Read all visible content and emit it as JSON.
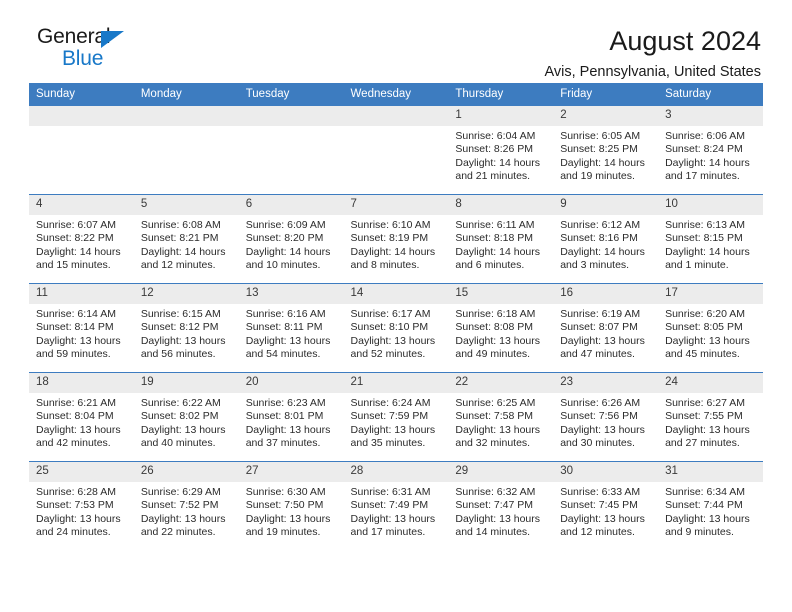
{
  "logo": {
    "word1": "General",
    "word2": "Blue",
    "triangle_color": "#1878c8",
    "icon": "triangle-icon"
  },
  "header": {
    "title": "August 2024",
    "subtitle": "Avis, Pennsylvania, United States"
  },
  "theme": {
    "header_band": "#3d7cc0",
    "daynum_band": "#ececec",
    "text": "#2b2b2b"
  },
  "weekday_headers": [
    "Sunday",
    "Monday",
    "Tuesday",
    "Wednesday",
    "Thursday",
    "Friday",
    "Saturday"
  ],
  "weeks": [
    [
      {
        "day": "",
        "lines": []
      },
      {
        "day": "",
        "lines": []
      },
      {
        "day": "",
        "lines": []
      },
      {
        "day": "",
        "lines": []
      },
      {
        "day": "1",
        "lines": [
          "Sunrise: 6:04 AM",
          "Sunset: 8:26 PM",
          "Daylight: 14 hours",
          "and 21 minutes."
        ]
      },
      {
        "day": "2",
        "lines": [
          "Sunrise: 6:05 AM",
          "Sunset: 8:25 PM",
          "Daylight: 14 hours",
          "and 19 minutes."
        ]
      },
      {
        "day": "3",
        "lines": [
          "Sunrise: 6:06 AM",
          "Sunset: 8:24 PM",
          "Daylight: 14 hours",
          "and 17 minutes."
        ]
      }
    ],
    [
      {
        "day": "4",
        "lines": [
          "Sunrise: 6:07 AM",
          "Sunset: 8:22 PM",
          "Daylight: 14 hours",
          "and 15 minutes."
        ]
      },
      {
        "day": "5",
        "lines": [
          "Sunrise: 6:08 AM",
          "Sunset: 8:21 PM",
          "Daylight: 14 hours",
          "and 12 minutes."
        ]
      },
      {
        "day": "6",
        "lines": [
          "Sunrise: 6:09 AM",
          "Sunset: 8:20 PM",
          "Daylight: 14 hours",
          "and 10 minutes."
        ]
      },
      {
        "day": "7",
        "lines": [
          "Sunrise: 6:10 AM",
          "Sunset: 8:19 PM",
          "Daylight: 14 hours",
          "and 8 minutes."
        ]
      },
      {
        "day": "8",
        "lines": [
          "Sunrise: 6:11 AM",
          "Sunset: 8:18 PM",
          "Daylight: 14 hours",
          "and 6 minutes."
        ]
      },
      {
        "day": "9",
        "lines": [
          "Sunrise: 6:12 AM",
          "Sunset: 8:16 PM",
          "Daylight: 14 hours",
          "and 3 minutes."
        ]
      },
      {
        "day": "10",
        "lines": [
          "Sunrise: 6:13 AM",
          "Sunset: 8:15 PM",
          "Daylight: 14 hours",
          "and 1 minute."
        ]
      }
    ],
    [
      {
        "day": "11",
        "lines": [
          "Sunrise: 6:14 AM",
          "Sunset: 8:14 PM",
          "Daylight: 13 hours",
          "and 59 minutes."
        ]
      },
      {
        "day": "12",
        "lines": [
          "Sunrise: 6:15 AM",
          "Sunset: 8:12 PM",
          "Daylight: 13 hours",
          "and 56 minutes."
        ]
      },
      {
        "day": "13",
        "lines": [
          "Sunrise: 6:16 AM",
          "Sunset: 8:11 PM",
          "Daylight: 13 hours",
          "and 54 minutes."
        ]
      },
      {
        "day": "14",
        "lines": [
          "Sunrise: 6:17 AM",
          "Sunset: 8:10 PM",
          "Daylight: 13 hours",
          "and 52 minutes."
        ]
      },
      {
        "day": "15",
        "lines": [
          "Sunrise: 6:18 AM",
          "Sunset: 8:08 PM",
          "Daylight: 13 hours",
          "and 49 minutes."
        ]
      },
      {
        "day": "16",
        "lines": [
          "Sunrise: 6:19 AM",
          "Sunset: 8:07 PM",
          "Daylight: 13 hours",
          "and 47 minutes."
        ]
      },
      {
        "day": "17",
        "lines": [
          "Sunrise: 6:20 AM",
          "Sunset: 8:05 PM",
          "Daylight: 13 hours",
          "and 45 minutes."
        ]
      }
    ],
    [
      {
        "day": "18",
        "lines": [
          "Sunrise: 6:21 AM",
          "Sunset: 8:04 PM",
          "Daylight: 13 hours",
          "and 42 minutes."
        ]
      },
      {
        "day": "19",
        "lines": [
          "Sunrise: 6:22 AM",
          "Sunset: 8:02 PM",
          "Daylight: 13 hours",
          "and 40 minutes."
        ]
      },
      {
        "day": "20",
        "lines": [
          "Sunrise: 6:23 AM",
          "Sunset: 8:01 PM",
          "Daylight: 13 hours",
          "and 37 minutes."
        ]
      },
      {
        "day": "21",
        "lines": [
          "Sunrise: 6:24 AM",
          "Sunset: 7:59 PM",
          "Daylight: 13 hours",
          "and 35 minutes."
        ]
      },
      {
        "day": "22",
        "lines": [
          "Sunrise: 6:25 AM",
          "Sunset: 7:58 PM",
          "Daylight: 13 hours",
          "and 32 minutes."
        ]
      },
      {
        "day": "23",
        "lines": [
          "Sunrise: 6:26 AM",
          "Sunset: 7:56 PM",
          "Daylight: 13 hours",
          "and 30 minutes."
        ]
      },
      {
        "day": "24",
        "lines": [
          "Sunrise: 6:27 AM",
          "Sunset: 7:55 PM",
          "Daylight: 13 hours",
          "and 27 minutes."
        ]
      }
    ],
    [
      {
        "day": "25",
        "lines": [
          "Sunrise: 6:28 AM",
          "Sunset: 7:53 PM",
          "Daylight: 13 hours",
          "and 24 minutes."
        ]
      },
      {
        "day": "26",
        "lines": [
          "Sunrise: 6:29 AM",
          "Sunset: 7:52 PM",
          "Daylight: 13 hours",
          "and 22 minutes."
        ]
      },
      {
        "day": "27",
        "lines": [
          "Sunrise: 6:30 AM",
          "Sunset: 7:50 PM",
          "Daylight: 13 hours",
          "and 19 minutes."
        ]
      },
      {
        "day": "28",
        "lines": [
          "Sunrise: 6:31 AM",
          "Sunset: 7:49 PM",
          "Daylight: 13 hours",
          "and 17 minutes."
        ]
      },
      {
        "day": "29",
        "lines": [
          "Sunrise: 6:32 AM",
          "Sunset: 7:47 PM",
          "Daylight: 13 hours",
          "and 14 minutes."
        ]
      },
      {
        "day": "30",
        "lines": [
          "Sunrise: 6:33 AM",
          "Sunset: 7:45 PM",
          "Daylight: 13 hours",
          "and 12 minutes."
        ]
      },
      {
        "day": "31",
        "lines": [
          "Sunrise: 6:34 AM",
          "Sunset: 7:44 PM",
          "Daylight: 13 hours",
          "and 9 minutes."
        ]
      }
    ]
  ]
}
